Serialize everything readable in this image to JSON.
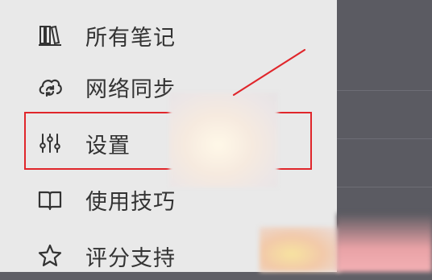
{
  "menu": {
    "items": [
      {
        "label": "所有笔记",
        "icon": "books-icon"
      },
      {
        "label": "网络同步",
        "icon": "cloud-sync-icon"
      },
      {
        "label": "设置",
        "icon": "sliders-icon"
      },
      {
        "label": "使用技巧",
        "icon": "book-open-icon"
      },
      {
        "label": "评分支持",
        "icon": "star-icon"
      }
    ]
  },
  "colors": {
    "drawer_bg": "#e9e9e9",
    "text": "#333333",
    "highlight": "#e0262b",
    "overlay": "#5b5b62"
  }
}
